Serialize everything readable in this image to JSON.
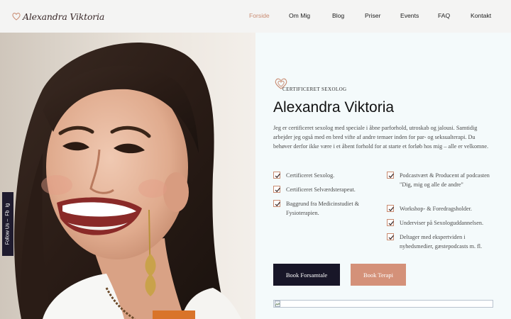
{
  "brand": {
    "logo_text": "Alexandra Viktoria"
  },
  "nav": {
    "items": [
      {
        "label": "Forside",
        "active": true
      },
      {
        "label": "Om Mig"
      },
      {
        "label": "Blog"
      },
      {
        "label": "Priser"
      },
      {
        "label": "Events"
      },
      {
        "label": "FAQ"
      },
      {
        "label": "Kontakt"
      }
    ]
  },
  "social": {
    "follow_label": "Follow Us –",
    "fb": "Fb",
    "ig": "Ig"
  },
  "hero": {
    "badge": "CERTIFICERET SEXOLOG",
    "title": "Alexandra Viktoria",
    "intro": "Jeg er certificeret sexolog med speciale i åbne parforhold, utroskab og jalousi. Samtidig arbejder jeg også med en bred vifte af andre temaer inden for par- og seksualterapi. Du behøver derfor ikke være i et åbent forhold for at starte et forløb hos mig – alle er velkomne.",
    "features_left": [
      "Certificeret Sexolog.",
      "Certificeret Selværdsterapeut.",
      "Baggrund fra Medicinstudiet & Fysioterapien."
    ],
    "features_right": [
      "Podcastvært & Producent af podcasten \"Dig, mig og alle de andre\"",
      "Workshop- & Foredragsholder.",
      "Underviser på Sexologuddannelsen.",
      "Deltager med ekspertviden i nyhedsmedier, gæstepodcasts m. fl."
    ],
    "buttons": {
      "primary": "Book Forsamtale",
      "secondary": "Book Terapi"
    }
  },
  "colors": {
    "accent": "#c98b71",
    "dark": "#181628",
    "rose": "#d49179",
    "panel_bg": "#f4fafb",
    "header_bg": "#f4f4f3"
  },
  "icons": {
    "logo": "heart-outline-icon",
    "badge": "heart-outline-icon",
    "check": "check-box-icon",
    "broken": "broken-image-icon"
  }
}
